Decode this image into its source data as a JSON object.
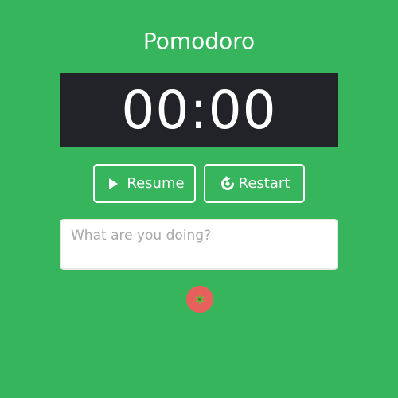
{
  "app": {
    "title": "Pomodoro"
  },
  "timer": {
    "display": "00:00"
  },
  "controls": {
    "resume_label": "Resume",
    "restart_label": "Restart",
    "resume_icon": "play-icon",
    "restart_icon": "restart-icon"
  },
  "task_input": {
    "placeholder": "What are you doing?",
    "value": ""
  },
  "tomato_button": {
    "icon": "tomato-icon",
    "color": "#e8605c"
  },
  "colors": {
    "background": "#37b55d",
    "timer_background": "#212329",
    "text": "#ffffff"
  }
}
